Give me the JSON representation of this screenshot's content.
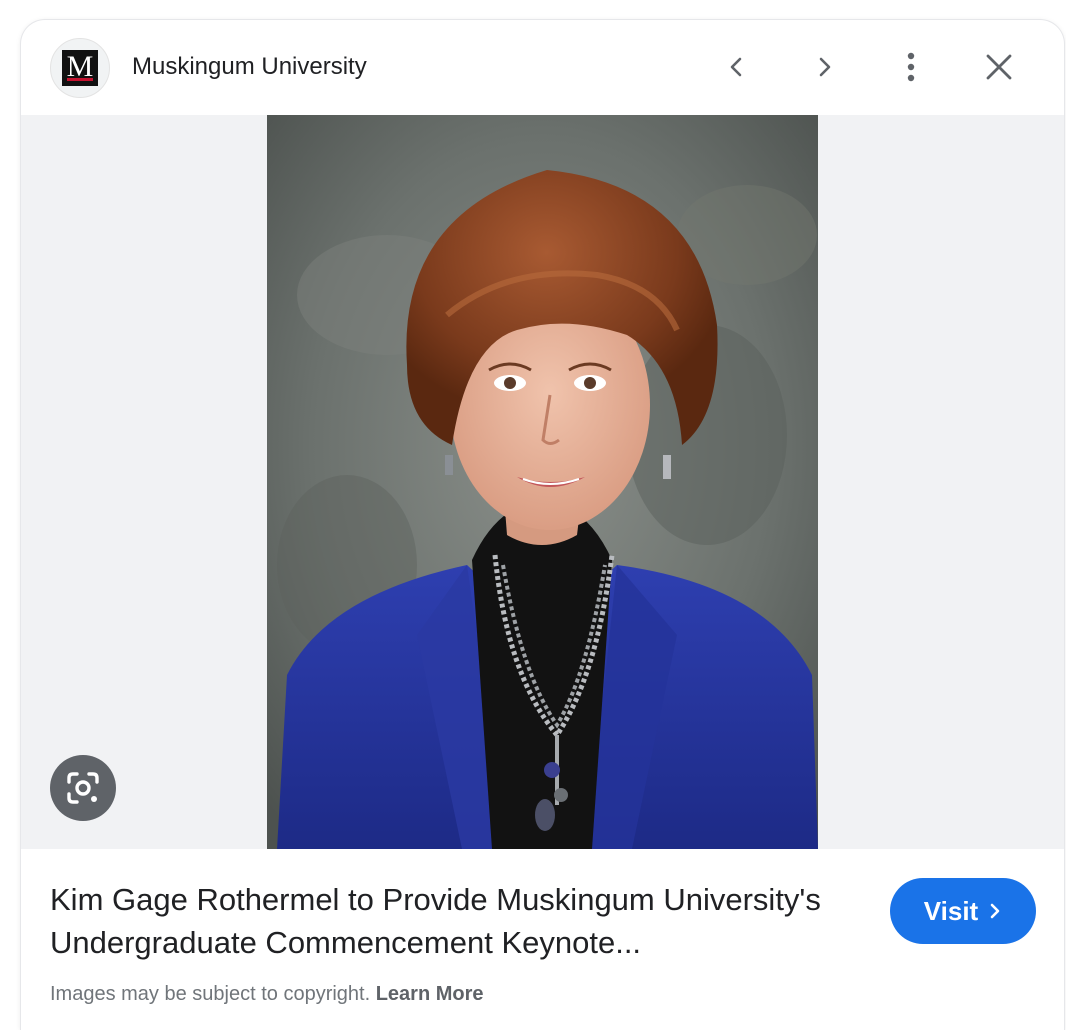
{
  "header": {
    "site_name": "Muskingum University",
    "logo_letter": "M",
    "icons": {
      "prev": "chevron-left-icon",
      "next": "chevron-right-icon",
      "more": "more-vert-icon",
      "close": "close-icon"
    }
  },
  "viewer": {
    "lens_icon": "google-lens-icon",
    "image_subject": "portrait"
  },
  "caption": {
    "title": "Kim Gage Rothermel to Provide Muskingum University's Undergraduate Commencement Keynote...",
    "visit_label": "Visit",
    "copyright_text": "Images may be subject to copyright.",
    "learn_more_label": "Learn More"
  },
  "colors": {
    "accent": "#1a73e8",
    "logo_bg": "#111111",
    "logo_bar": "#c4122f",
    "image_backdrop": "#f1f2f4"
  }
}
